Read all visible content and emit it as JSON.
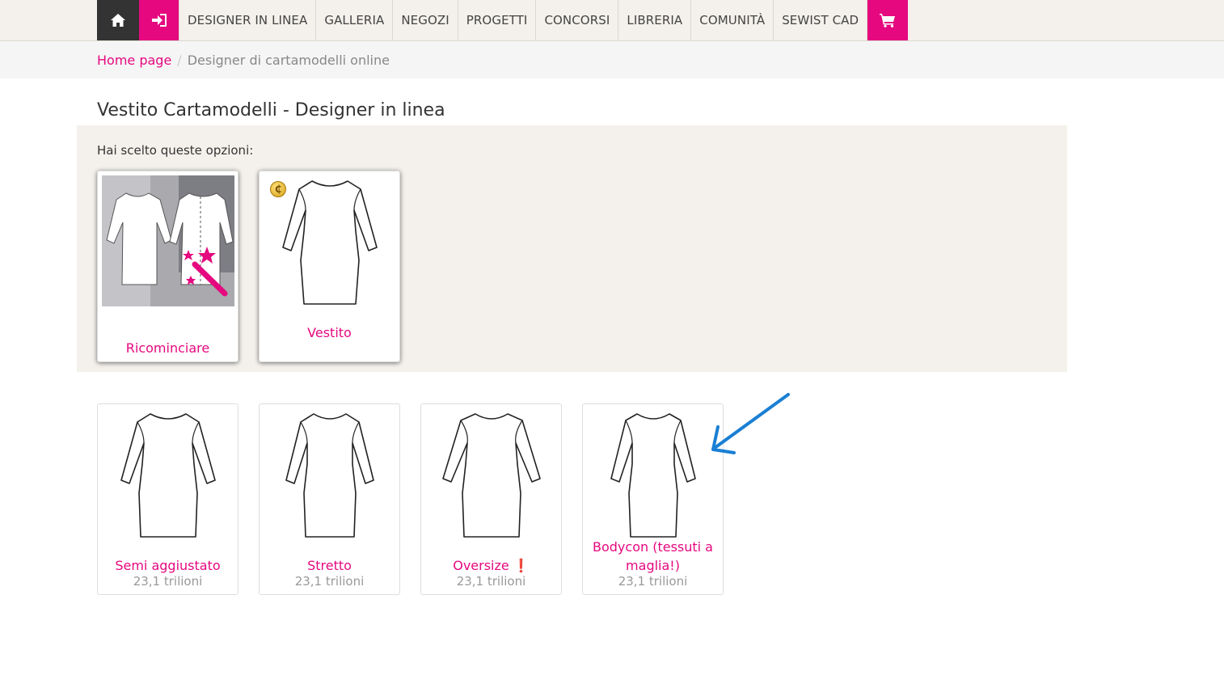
{
  "nav": {
    "items": [
      {
        "key": "designer",
        "label": "DESIGNER IN LINEA"
      },
      {
        "key": "galleria",
        "label": "GALLERIA"
      },
      {
        "key": "negozi",
        "label": "NEGOZI"
      },
      {
        "key": "progetti",
        "label": "PROGETTI"
      },
      {
        "key": "concorsi",
        "label": "CONCORSI"
      },
      {
        "key": "libreria",
        "label": "LIBRERIA"
      },
      {
        "key": "comunita",
        "label": "COMUNITÀ"
      },
      {
        "key": "sewist",
        "label": "SEWIST CAD"
      }
    ],
    "icons": {
      "home": "home-icon",
      "login": "sign-in-icon",
      "cart": "shopping-cart-icon"
    }
  },
  "breadcrumb": {
    "home": "Home page",
    "separator": "/",
    "current": "Designer di cartamodelli online"
  },
  "page": {
    "title": "Vestito Cartamodelli - Designer in linea"
  },
  "chosen": {
    "label": "Hai scelto queste opzioni:",
    "cards": [
      {
        "title": "Ricominciare"
      },
      {
        "title": "Vestito"
      }
    ]
  },
  "options": [
    {
      "title": "Semi aggiustato",
      "count": "23,1 trilioni"
    },
    {
      "title": "Stretto",
      "count": "23,1 trilioni"
    },
    {
      "title": "Oversize",
      "badge": "❗",
      "count": "23,1 trilioni"
    },
    {
      "title": "Bodycon (tessuti a maglia!)",
      "count": "23,1 trilioni"
    }
  ],
  "colors": {
    "accent": "#e5087f",
    "nav_dark": "#333333",
    "panel_bg": "#f4f1ec",
    "annotation_arrow": "#1a7fd4"
  }
}
